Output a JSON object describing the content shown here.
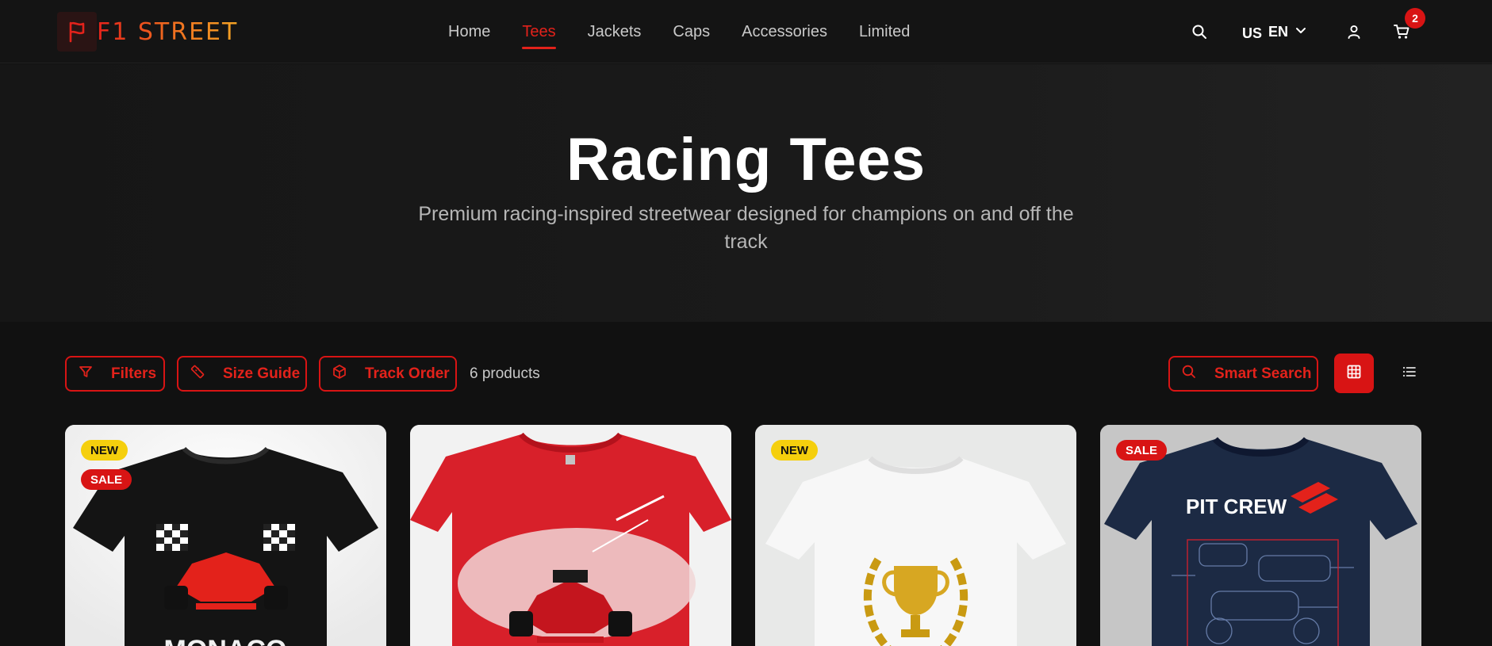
{
  "header": {
    "logo_text": "F1 STREET",
    "nav": [
      "Home",
      "Tees",
      "Jackets",
      "Caps",
      "Accessories",
      "Limited"
    ],
    "active_nav": "Tees",
    "language": {
      "flag": "US",
      "code": "EN"
    },
    "cart_count": "2"
  },
  "hero": {
    "title": "Racing Tees",
    "subtitle": "Premium racing-inspired streetwear designed for champions on and off the track"
  },
  "toolbar": {
    "filters_label": "Filters",
    "size_guide_label": "Size Guide",
    "track_order_label": "Track Order",
    "product_count": "6 products",
    "smart_search_label": "Smart Search",
    "active_view": "grid"
  },
  "products": [
    {
      "badges": [
        "NEW",
        "SALE"
      ],
      "shirt_color": "black",
      "print_text": "MONACO"
    },
    {
      "badges": [],
      "shirt_color": "red",
      "print_text": ""
    },
    {
      "badges": [
        "NEW"
      ],
      "shirt_color": "white",
      "print_text": ""
    },
    {
      "badges": [
        "SALE"
      ],
      "shirt_color": "navy",
      "print_text": "PIT CREW"
    }
  ],
  "colors": {
    "accent": "#d81414",
    "new_badge": "#f5cf0d",
    "background": "#111111"
  },
  "icons": {
    "logo": "flag-icon",
    "search": "search-icon",
    "language_dropdown": "chevron-down-icon",
    "account": "user-icon",
    "cart": "cart-icon",
    "filters": "filter-icon",
    "size_guide": "ruler-icon",
    "track_order": "package-icon",
    "smart_search": "search-icon",
    "grid_view": "grid-icon",
    "list_view": "list-icon"
  }
}
